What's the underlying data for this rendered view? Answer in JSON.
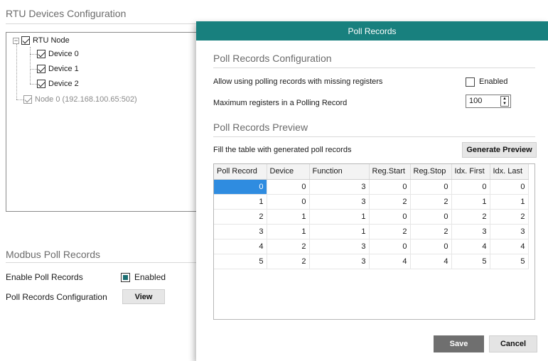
{
  "rtu_section": {
    "title": "RTU Devices Configuration",
    "tree": {
      "root": {
        "label": "RTU Node",
        "checked": true
      },
      "devices": [
        {
          "label": "Device 0",
          "checked": true
        },
        {
          "label": "Device 1",
          "checked": true
        },
        {
          "label": "Device 2",
          "checked": true
        }
      ],
      "node0": {
        "label": "Node 0 (192.168.100.65:502)",
        "checked": true
      }
    }
  },
  "modbus_section": {
    "title": "Modbus Poll Records",
    "enable_label": "Enable Poll Records",
    "enable_checkbox_label": "Enabled",
    "enable_checked": true,
    "config_label": "Poll Records Configuration",
    "view_button": "View"
  },
  "dialog": {
    "title": "Poll Records",
    "config_title": "Poll Records Configuration",
    "allow_missing_label": "Allow using polling records with missing registers",
    "allow_missing_checkbox_label": "Enabled",
    "allow_missing_checked": false,
    "max_registers_label": "Maximum registers in a Polling Record",
    "max_registers_value": "100",
    "preview_title": "Poll Records Preview",
    "fill_label": "Fill the table with generated poll records",
    "generate_button": "Generate Preview",
    "table": {
      "headers": [
        "Poll Record",
        "Device",
        "Function",
        "Reg.Start",
        "Reg.Stop",
        "Idx. First",
        "Idx. Last"
      ],
      "rows": [
        [
          "0",
          "0",
          "3",
          "0",
          "0",
          "0",
          "0"
        ],
        [
          "1",
          "0",
          "3",
          "2",
          "2",
          "1",
          "1"
        ],
        [
          "2",
          "1",
          "1",
          "0",
          "0",
          "2",
          "2"
        ],
        [
          "3",
          "1",
          "1",
          "2",
          "2",
          "3",
          "3"
        ],
        [
          "4",
          "2",
          "3",
          "0",
          "0",
          "4",
          "4"
        ],
        [
          "5",
          "2",
          "3",
          "4",
          "4",
          "5",
          "5"
        ]
      ]
    },
    "save_button": "Save",
    "cancel_button": "Cancel"
  },
  "colors": {
    "title_bar": "#18807e",
    "selection": "#2f8ce0",
    "checkbox_fill": "#1b6e72"
  }
}
